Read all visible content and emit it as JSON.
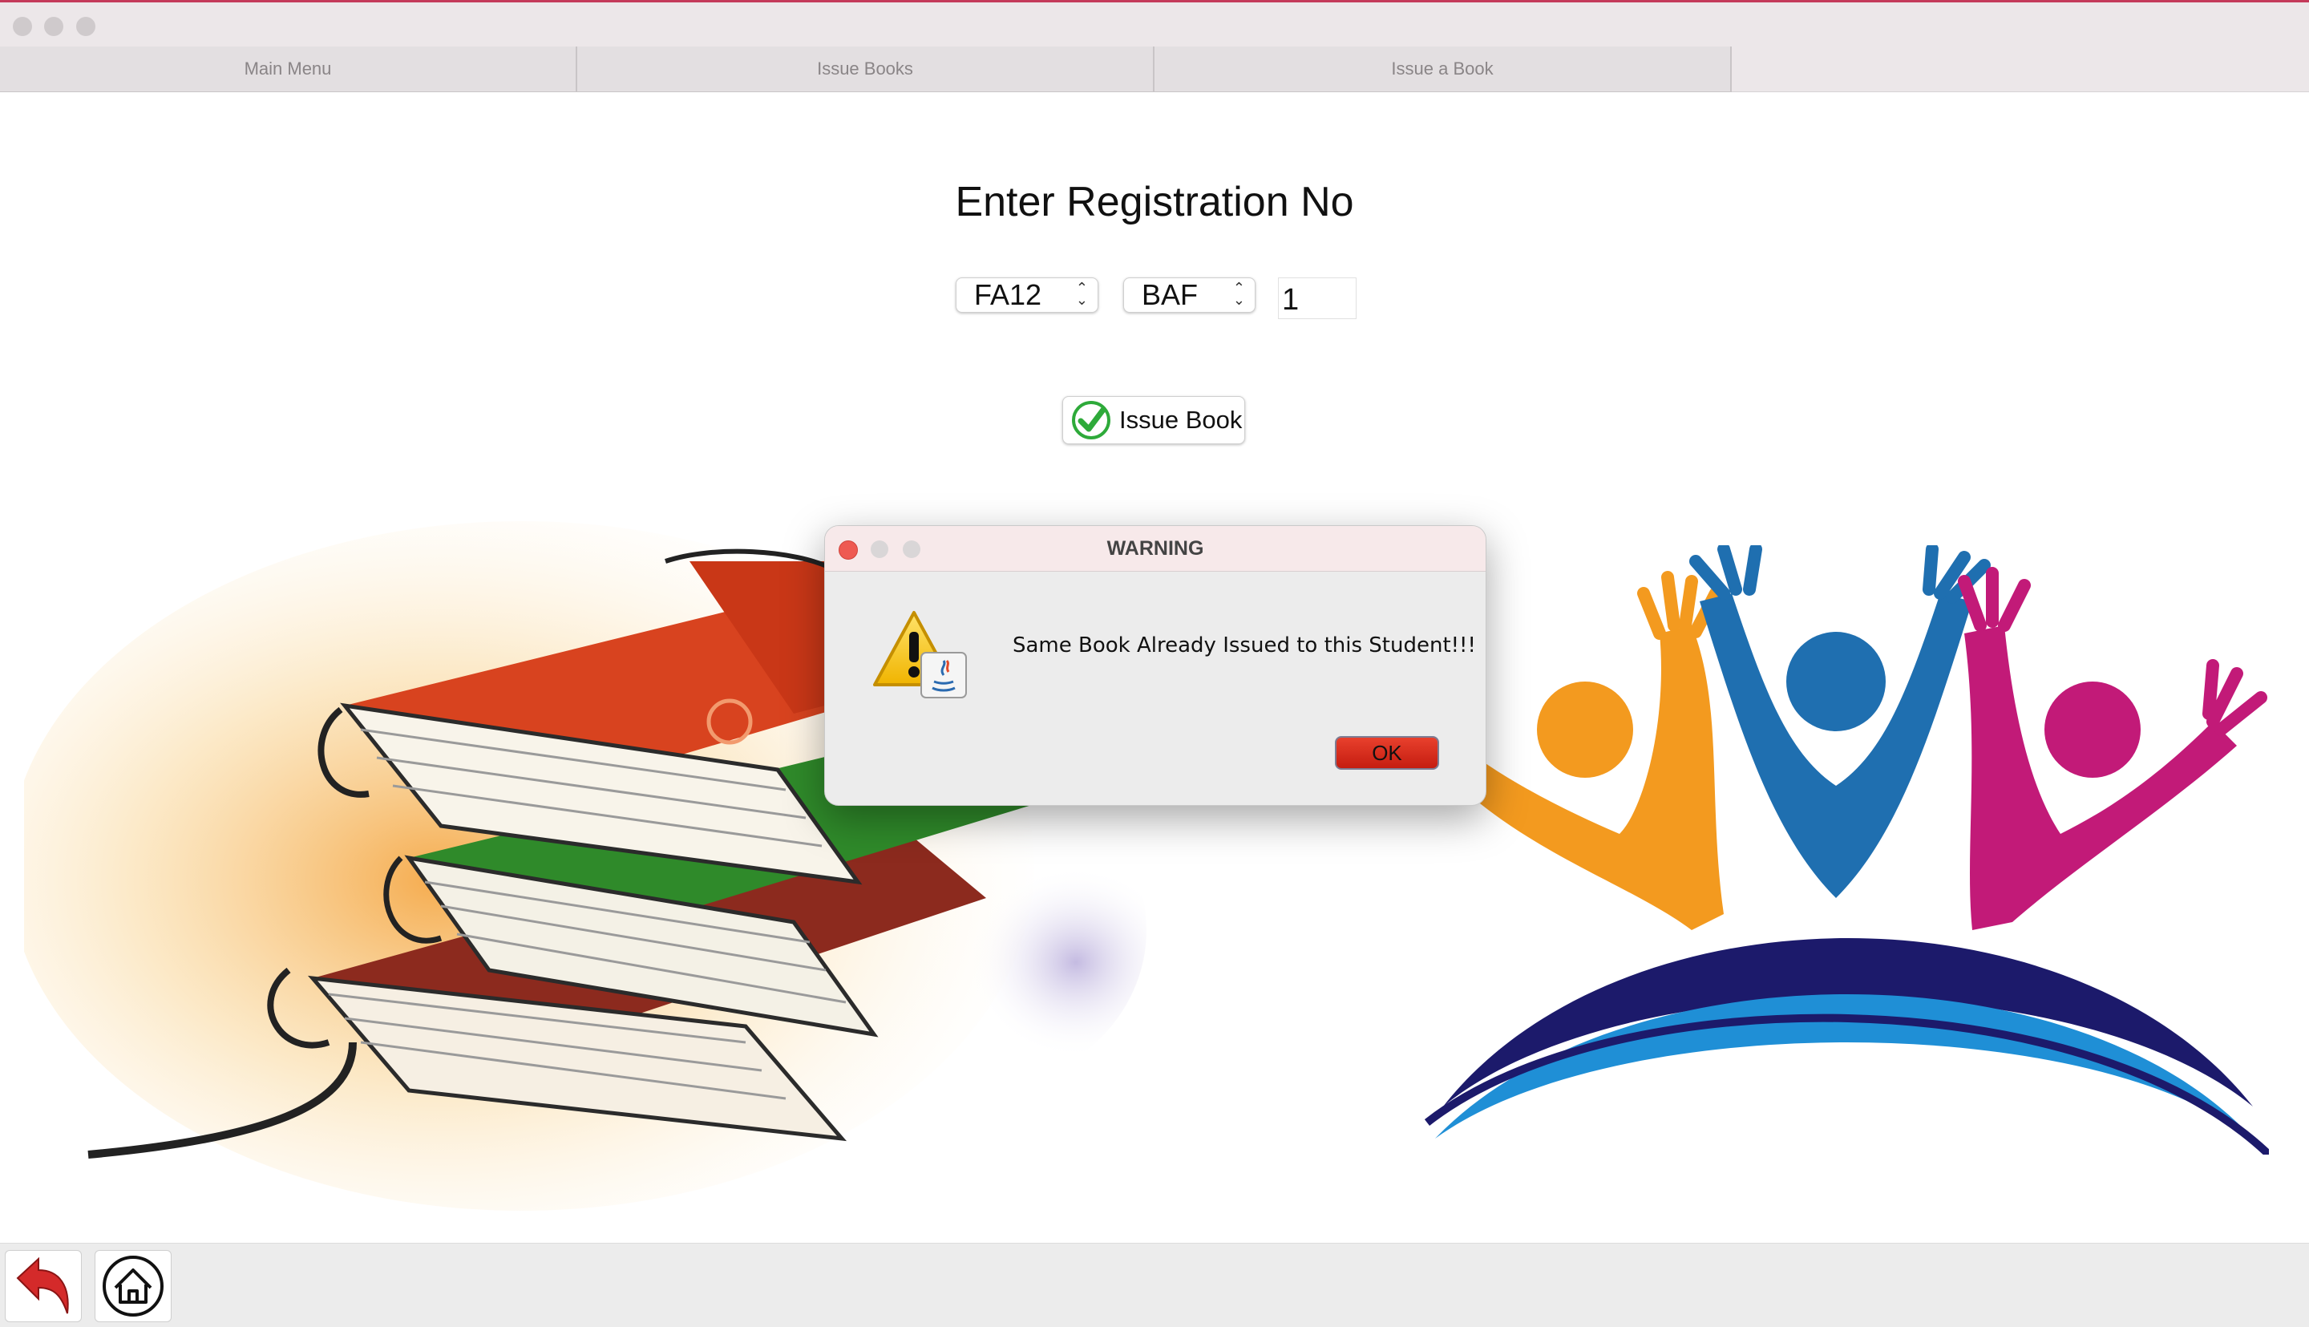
{
  "window": {
    "tabs": [
      {
        "label": "Main Menu"
      },
      {
        "label": "Issue Books"
      },
      {
        "label": "Issue a Book"
      }
    ]
  },
  "form": {
    "heading": "Enter Registration No",
    "session_select": "FA12",
    "program_select": "BAF",
    "roll_number": "1",
    "issue_button": "Issue Book"
  },
  "dialog": {
    "title": "WARNING",
    "message": "Same Book Already Issued to this Student!!!",
    "ok_label": "OK"
  },
  "icons": {
    "back": "back-arrow-icon",
    "home": "home-icon",
    "check": "checkmark-icon",
    "warning": "warning-icon"
  },
  "colors": {
    "ok_button": "#d9301f",
    "check_green": "#2eaa3a",
    "window_accent": "#c43a5a"
  }
}
